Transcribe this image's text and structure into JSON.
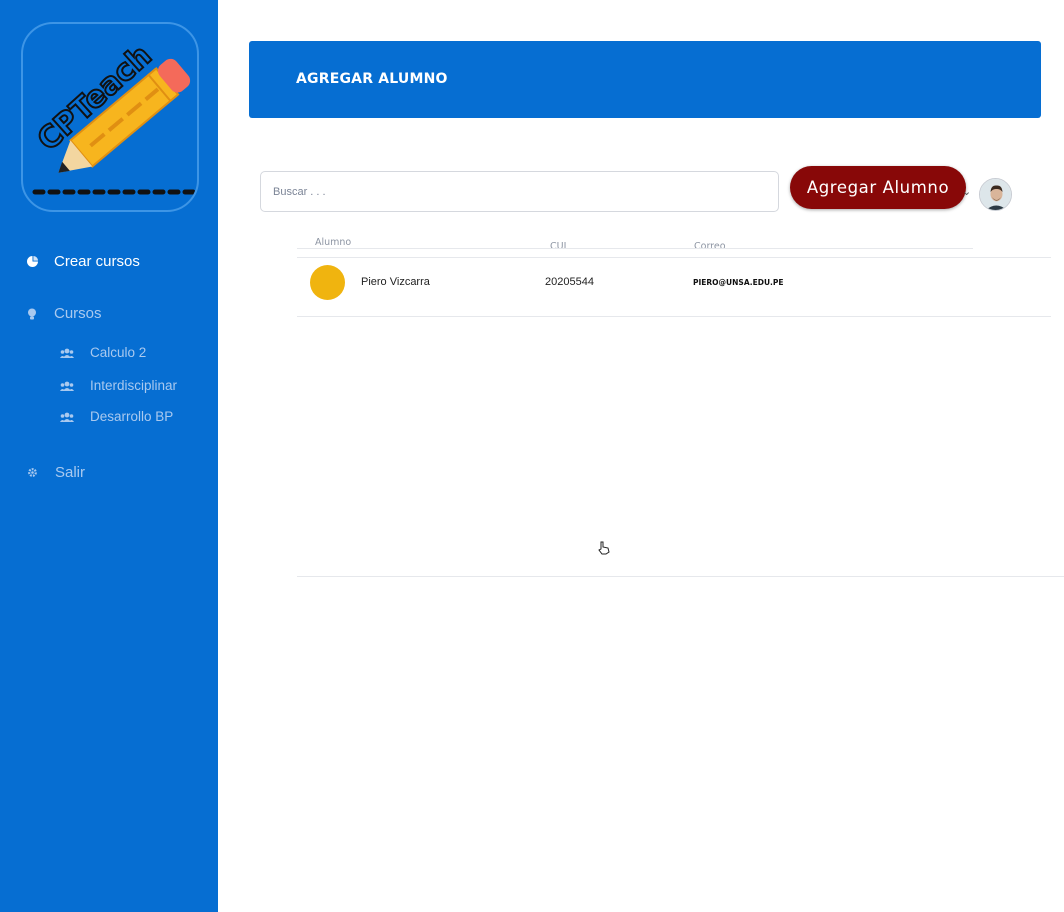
{
  "sidebar": {
    "logo_text": "CPTeach",
    "items": [
      {
        "label": "Crear cursos",
        "icon": "pie-chart-icon"
      },
      {
        "label": "Cursos",
        "icon": "lightbulb-icon"
      },
      {
        "label": "Calculo 2",
        "icon": "users-icon"
      },
      {
        "label": "Interdisciplinar",
        "icon": "users-icon"
      },
      {
        "label": "Desarrollo BP",
        "icon": "users-icon"
      },
      {
        "label": "Salir",
        "icon": "gear-icon"
      }
    ]
  },
  "header": {
    "title": "AGREGAR ALUMNO"
  },
  "search": {
    "placeholder": "Buscar . . ."
  },
  "toolbar": {
    "add_label": "Agregar Alumno"
  },
  "table": {
    "columns": [
      "Alumno",
      "CUI",
      "Correo"
    ],
    "rows": [
      {
        "name": "Piero Vizcarra",
        "cui": "20205544",
        "correo": "PIERO@UNSA.EDU.PE"
      }
    ]
  },
  "colors": {
    "primary": "#066ed2",
    "accent_button": "#880808",
    "avatar_dot": "#f0b40f"
  }
}
